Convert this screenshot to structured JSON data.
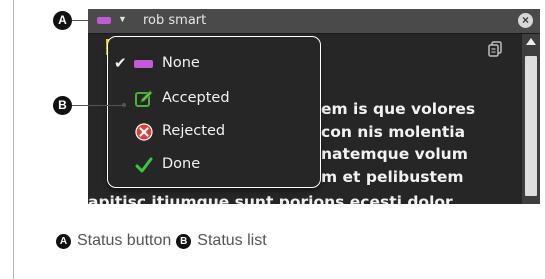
{
  "callouts": {
    "a_label": "A",
    "b_label": "B"
  },
  "window": {
    "author": "rob smart",
    "close_glyph": "×",
    "status_color": "#c15ad6",
    "status_caret": "▼"
  },
  "note_text": {
    "lines": [
      "em is que volores",
      "con nis molentia",
      "natemque volum",
      "m et pelibustem",
      "apitisc itiumque sunt porions ecesti dolor"
    ]
  },
  "status_menu": {
    "items": [
      {
        "label": "None",
        "icon": "purple-swatch",
        "checked": true
      },
      {
        "label": "Accepted",
        "icon": "pencil-accepted-icon",
        "checked": false
      },
      {
        "label": "Rejected",
        "icon": "rejected-x-icon",
        "checked": false
      },
      {
        "label": "Done",
        "icon": "green-check-icon",
        "checked": false
      }
    ],
    "check_glyph": "✔"
  },
  "legend": {
    "a_text": "Status button",
    "b_text": "Status list"
  }
}
